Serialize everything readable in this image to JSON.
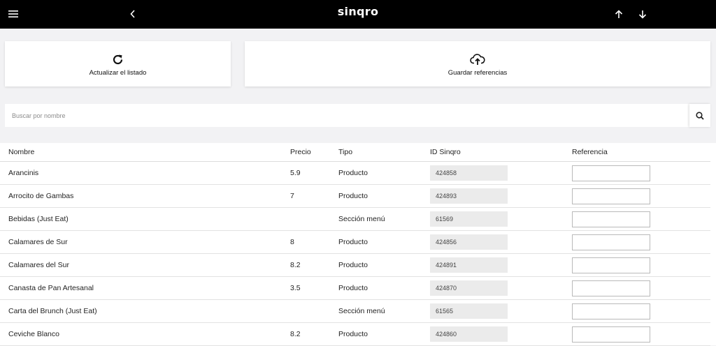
{
  "header": {
    "logo": "sinqro",
    "icons": {
      "menu": "hamburger-menu-icon",
      "back": "chevron-left-icon",
      "up": "arrow-up-icon",
      "down": "arrow-down-icon"
    }
  },
  "actions": {
    "refresh": {
      "label": "Actualizar el listado",
      "icon": "refresh-icon"
    },
    "save": {
      "label": "Guardar referencias",
      "icon": "cloud-upload-icon"
    }
  },
  "search": {
    "placeholder": "Buscar por nombre",
    "value": "",
    "icon": "search-icon"
  },
  "table": {
    "columns": {
      "name": "Nombre",
      "price": "Precio",
      "type": "Tipo",
      "id": "ID Sinqro",
      "reference": "Referencia"
    },
    "rows": [
      {
        "name": "Arancinis",
        "price": "5.9",
        "type": "Producto",
        "id": "424858",
        "reference": ""
      },
      {
        "name": "Arrocito de Gambas",
        "price": "7",
        "type": "Producto",
        "id": "424893",
        "reference": ""
      },
      {
        "name": "Bebidas (Just Eat)",
        "price": "",
        "type": "Sección menú",
        "id": "61569",
        "reference": ""
      },
      {
        "name": "Calamares de Sur",
        "price": "8",
        "type": "Producto",
        "id": "424856",
        "reference": ""
      },
      {
        "name": "Calamares del Sur",
        "price": "8.2",
        "type": "Producto",
        "id": "424891",
        "reference": ""
      },
      {
        "name": "Canasta de Pan Artesanal",
        "price": "3.5",
        "type": "Producto",
        "id": "424870",
        "reference": ""
      },
      {
        "name": "Carta del Brunch (Just Eat)",
        "price": "",
        "type": "Sección menú",
        "id": "61565",
        "reference": ""
      },
      {
        "name": "Ceviche Blanco",
        "price": "8.2",
        "type": "Producto",
        "id": "424860",
        "reference": ""
      }
    ]
  },
  "colors": {
    "topbar": "#000000",
    "background": "#f2f2f4",
    "card": "#ffffff",
    "id_field": "#ebebeb"
  }
}
